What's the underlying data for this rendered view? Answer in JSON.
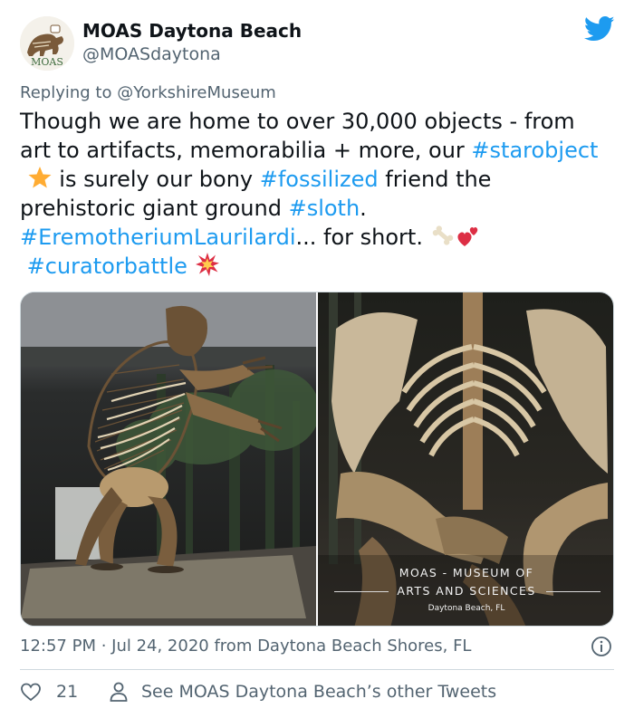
{
  "account": {
    "name": "MOAS Daytona Beach",
    "handle": "@MOASdaytona",
    "avatar_icon": "moas-logo"
  },
  "brand": {
    "bird_icon": "twitter-bird-icon",
    "color": "#1d9bf0"
  },
  "reply": {
    "prefix": "Replying to ",
    "mention": "@YorkshireMuseum"
  },
  "body": {
    "l1": "Though we are home to over 30,000 objects - from",
    "l2_a": "art to artifacts, memorabilia + more, our ",
    "l2_tag": "#starobject",
    "l3_a": " is surely our bony ",
    "l3_tag": "#fossilized",
    "l3_b": " friend the",
    "l4_a": "prehistoric giant ground ",
    "l4_tag": "#sloth",
    "l4_b": ".",
    "l5_tag": "#EremotheriumLaurilardi",
    "l5_b": "... for short. ",
    "l6_tag": "#curatorbattle",
    "emojis": [
      "star-emoji",
      "bone-emoji",
      "two-hearts-emoji",
      "collision-emoji"
    ]
  },
  "media": {
    "caption_line1": "MOAS - MUSEUM OF",
    "caption_line2": "ARTS AND SCIENCES",
    "caption_line3": "Daytona Beach, FL"
  },
  "meta": {
    "text": "12:57 PM · Jul 24, 2020 from Daytona Beach Shores, FL",
    "info_icon": "info-icon"
  },
  "footer": {
    "like_count": "21",
    "like_icon": "heart-icon",
    "person_icon": "person-icon",
    "other_label": "See MOAS Daytona Beach’s other Tweets"
  }
}
